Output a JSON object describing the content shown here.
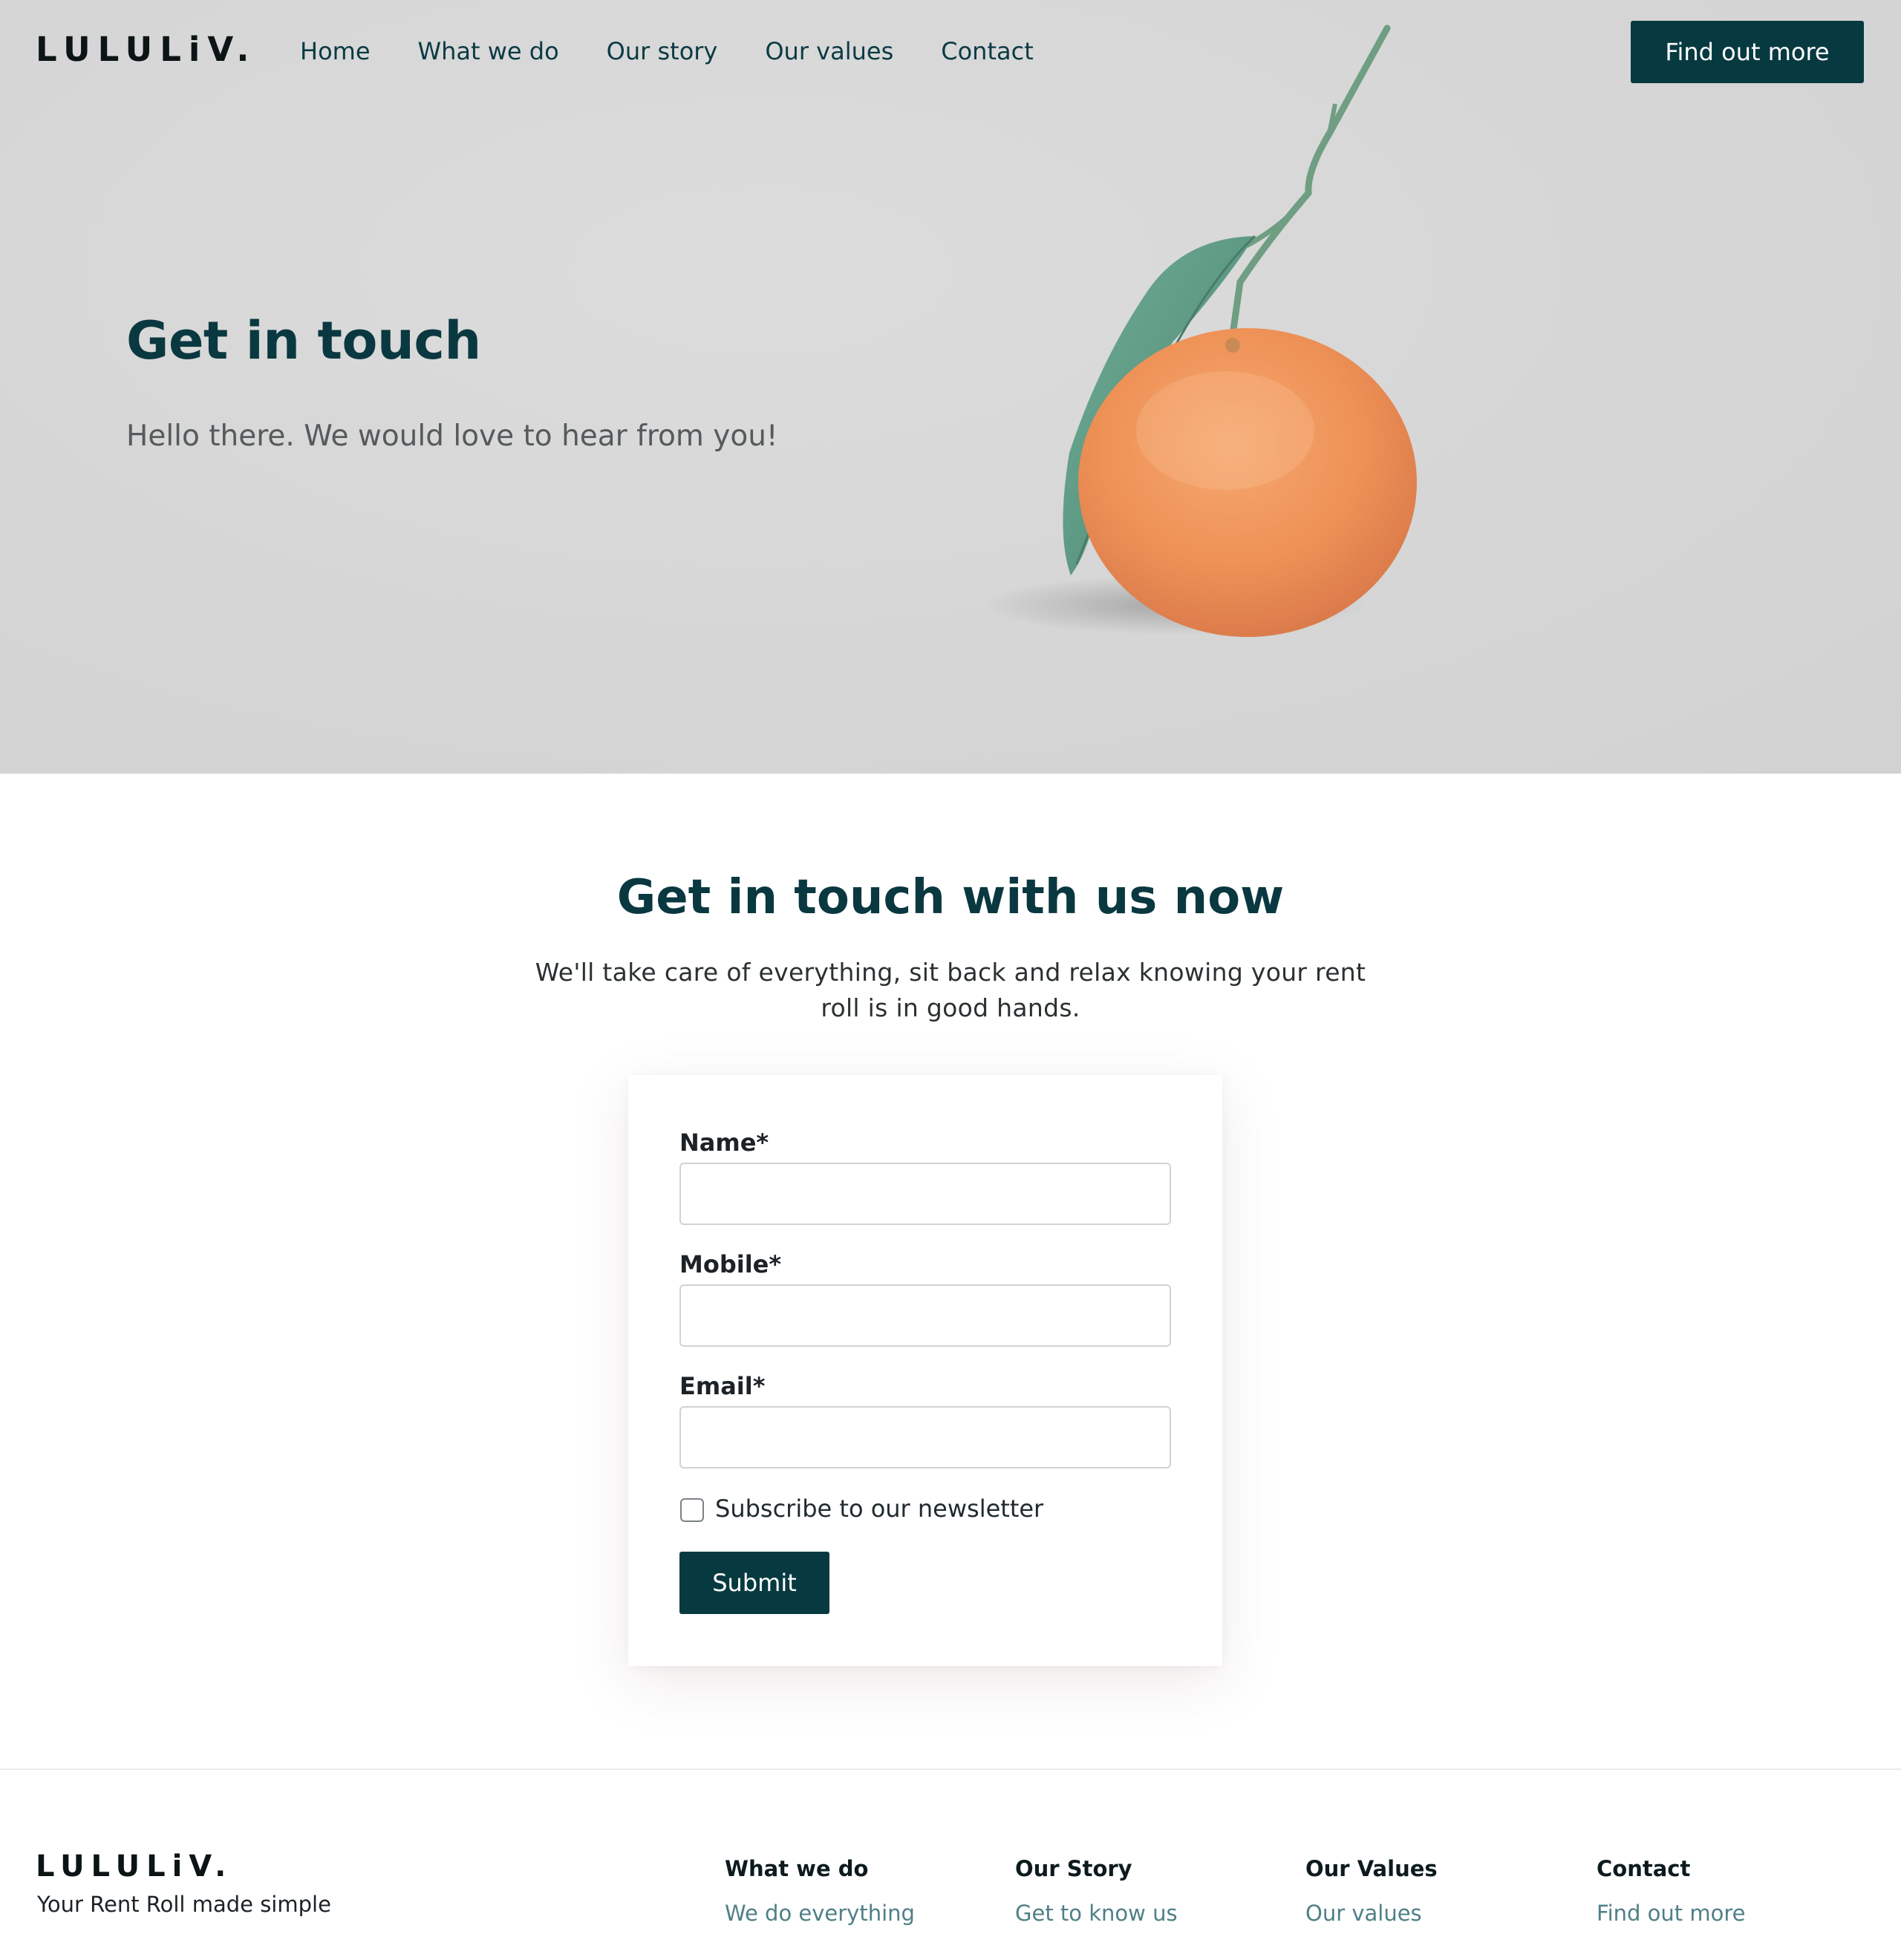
{
  "brand": {
    "logo_text": "LULULiV.",
    "tagline": "Your Rent Roll made simple"
  },
  "nav": {
    "items": [
      "Home",
      "What we do",
      "Our story",
      "Our values",
      "Contact"
    ],
    "cta_label": "Find out more"
  },
  "hero": {
    "title": "Get in touch",
    "subtitle": "Hello there. We would love to hear from you!",
    "image": "orange-with-leaf-illustration"
  },
  "contact": {
    "title": "Get in touch with us now",
    "subtitle": "We'll take care of everything, sit back and relax knowing your rent roll is in good hands.",
    "form": {
      "name_label": "Name*",
      "name_value": "",
      "mobile_label": "Mobile*",
      "mobile_value": "",
      "email_label": "Email*",
      "email_value": "",
      "newsletter_label": "Subscribe to our newsletter",
      "newsletter_checked": false,
      "submit_label": "Submit"
    }
  },
  "footer": {
    "columns": [
      {
        "heading": "What we do",
        "links": [
          "We do everything"
        ]
      },
      {
        "heading": "Our Story",
        "links": [
          "Get to know us"
        ]
      },
      {
        "heading": "Our Values",
        "links": [
          "Our values"
        ]
      },
      {
        "heading": "Contact",
        "links": [
          "Find out more"
        ]
      }
    ]
  },
  "colors": {
    "primary": "#073a40",
    "heading": "#0a3840",
    "hero_bg": "#d7d7d7",
    "footer_link": "#4f7f87",
    "orange": "#f39a5c",
    "leaf": "#5f9a86"
  }
}
